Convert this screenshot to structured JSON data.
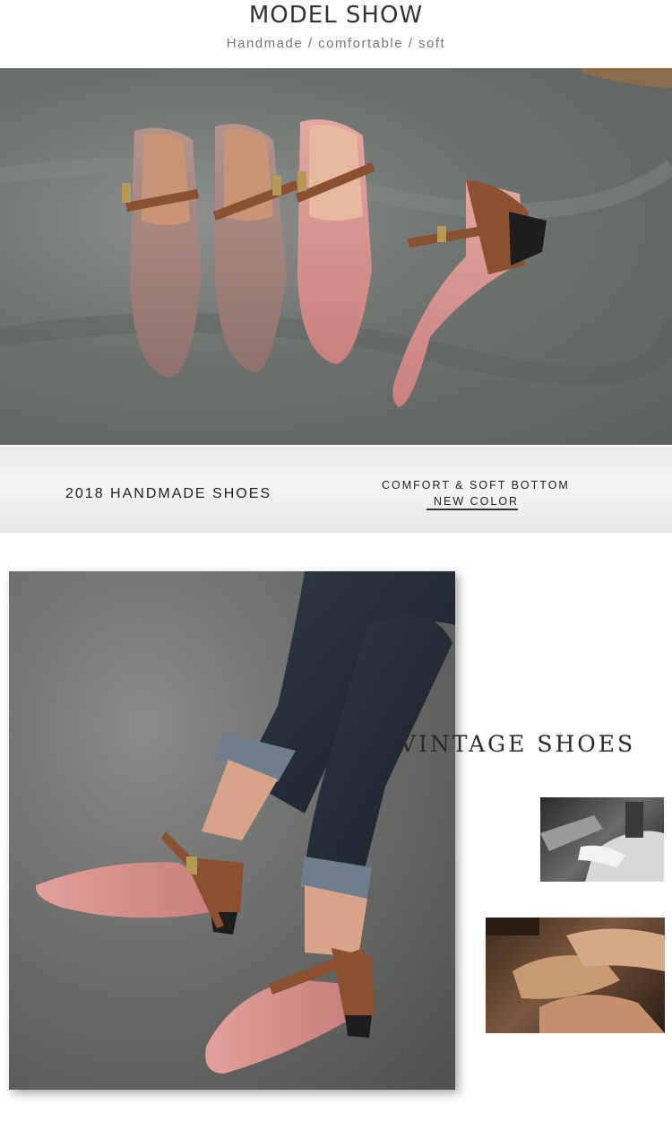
{
  "header": {
    "title": "MODEL SHOW",
    "subtitle": "Handmade / comfortable / soft"
  },
  "banner": {
    "left_text": "2018 HANDMADE SHOES",
    "right_top": "COMFORT & SOFT BOTTOM",
    "right_bottom": "NEW COLOR"
  },
  "feature": {
    "title": "VINTAGE SHOES"
  },
  "colors": {
    "pink_leather": "#d98f8f",
    "taupe_leather": "#a48680",
    "brown_strap": "#8a5030",
    "background_gray": "#6d716e"
  }
}
